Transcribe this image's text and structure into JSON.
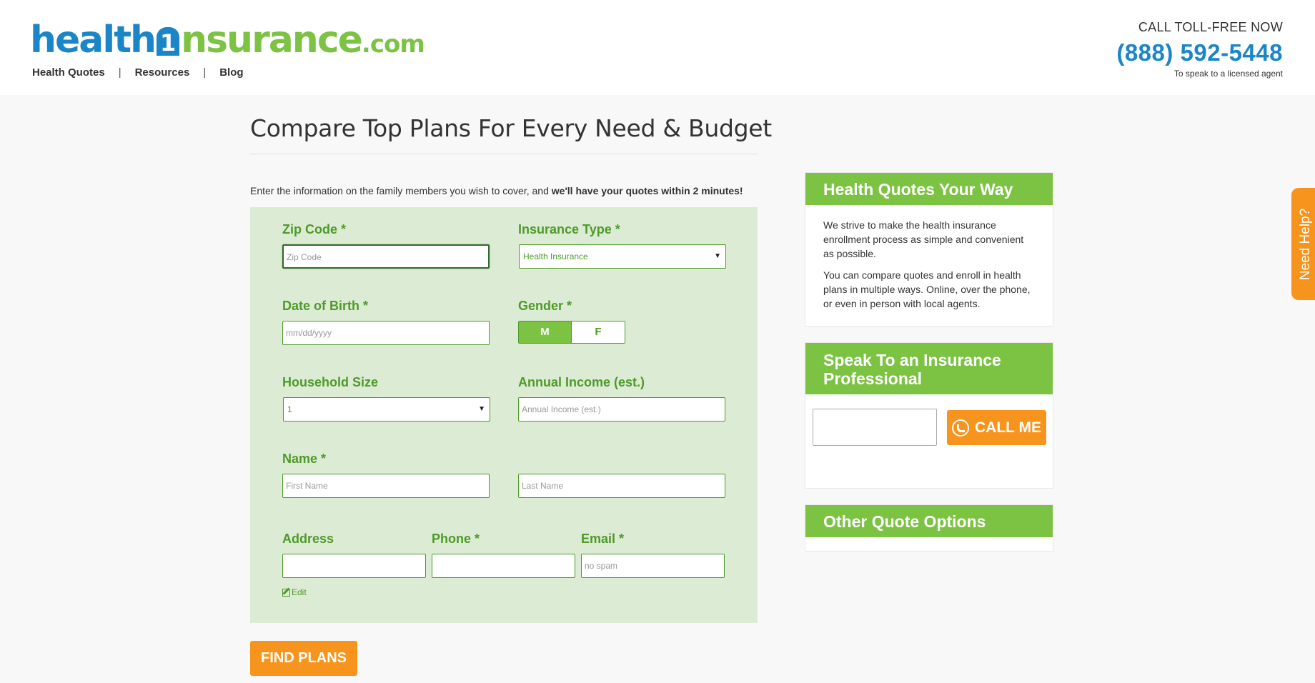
{
  "brand": {
    "logo_part1": "health",
    "logo_badge": "1",
    "logo_part2": "nsurance",
    "logo_tld": ".com",
    "colors": {
      "blue": "#1a86c8",
      "green": "#7cc243",
      "dark_green": "#4e9a2a",
      "orange": "#f7941d",
      "form_bg": "#dcebd3"
    }
  },
  "nav": {
    "items": [
      "Health Quotes",
      "Resources",
      "Blog"
    ],
    "separator": "|"
  },
  "call": {
    "label": "CALL TOLL-FREE NOW",
    "phone": "(888) 592-5448",
    "sub": "To speak to a licensed agent"
  },
  "main": {
    "title": "Compare Top Plans For Every Need & Budget",
    "intro_plain": "Enter the information on the family members you wish to cover, and ",
    "intro_bold": "we'll have your quotes within 2 minutes!"
  },
  "form": {
    "zip": {
      "label": "Zip Code *",
      "placeholder": "Zip Code"
    },
    "insurance_type": {
      "label": "Insurance Type *",
      "value": "Health Insurance"
    },
    "dob": {
      "label": "Date of Birth *",
      "placeholder": "mm/dd/yyyy"
    },
    "gender": {
      "label": "Gender *",
      "options": [
        "M",
        "F"
      ],
      "selected": "M"
    },
    "household": {
      "label": "Household Size",
      "value": "1"
    },
    "income": {
      "label": "Annual Income (est.)",
      "placeholder": "Annual Income (est.)"
    },
    "name": {
      "label": "Name *",
      "first_placeholder": "First Name",
      "last_placeholder": "Last Name"
    },
    "address": {
      "label": "Address",
      "placeholder": ""
    },
    "phone": {
      "label": "Phone *",
      "placeholder": ""
    },
    "email": {
      "label": "Email *",
      "placeholder": "no spam"
    },
    "edit_label": "Edit",
    "submit_label": "FIND PLANS"
  },
  "sidebar": {
    "quotes_card": {
      "title": "Health Quotes Your Way",
      "para1": "We strive to make the health insurance enrollment process as simple and convenient as possible.",
      "para2": "You can compare quotes and enroll in health plans in multiple ways. Online, over the phone, or even in person with local agents."
    },
    "speak_card": {
      "title": "Speak To an Insurance Professional",
      "button_label": "CALL ME"
    },
    "other_card": {
      "title": "Other Quote Options"
    }
  },
  "help_tab": {
    "label": "Need Help?"
  }
}
